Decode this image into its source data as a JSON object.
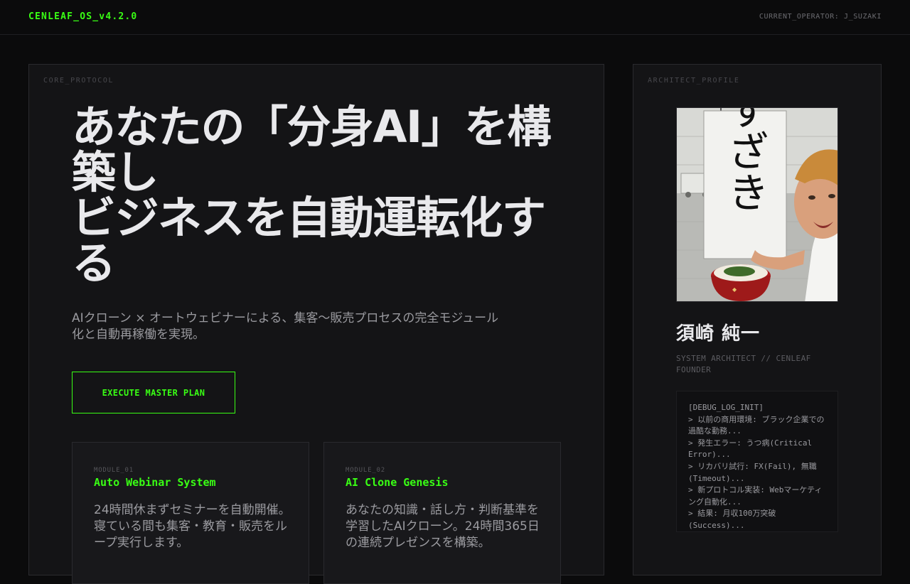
{
  "header": {
    "brand": "CENLEAF_OS_v4.2.0",
    "operator": "CURRENT_OPERATOR: J_SUZAKI"
  },
  "main": {
    "label": "CORE_PROTOCOL",
    "hero_lines": [
      "あなたの「分身AI」を構",
      "築し",
      "ビジネスを自動運転化す",
      "る"
    ],
    "subtitle": "AIクローン × オートウェビナーによる、集客〜販売プロセスの完全モジュール化と自動再稼働を実現。",
    "cta_label": "EXECUTE MASTER PLAN",
    "modules": [
      {
        "tag": "MODULE_01",
        "title": "Auto Webinar System",
        "desc": "24時間休まずセミナーを自動開催。寝ている間も集客・教育・販売をループ実行します。"
      },
      {
        "tag": "MODULE_02",
        "title": "AI Clone Genesis",
        "desc": "あなたの知識・話し方・判断基準を学習したAIクローン。24時間365日の連続プレゼンスを構築。"
      }
    ]
  },
  "side": {
    "label": "ARCHITECT_PROFILE",
    "photo_sign_text": "すざき",
    "name": "須崎 純一",
    "role": "SYSTEM ARCHITECT // CENLEAF FOUNDER",
    "log_lines": [
      "[DEBUG_LOG_INIT]",
      "> 以前の商用環境: ブラック企業での過酷な勤務...",
      "> 発生エラー: うつ病(Critical Error)...",
      "> リカバリ試行: FX(Fail), 無職(Timeout)...",
      "> 新プロトコル実装: Webマーケティング自動化...",
      "> 結果: 月収100万突破(Success)..."
    ]
  },
  "colors": {
    "accent": "#39ff14",
    "background": "#0b0b0c",
    "panel": "#141416",
    "text": "#e9e9ec",
    "muted": "#9b9ba0"
  }
}
